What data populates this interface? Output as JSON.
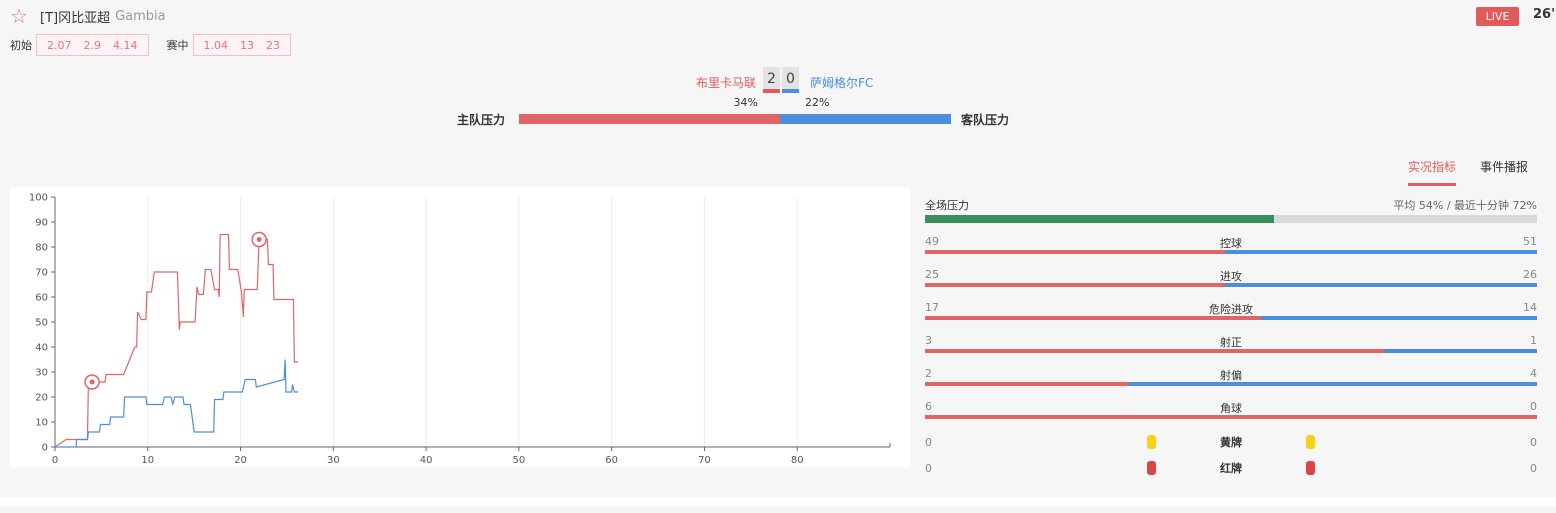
{
  "header": {
    "favorite_icon": "star-outline-icon",
    "league": "[T]冈比亚超",
    "league_en": "Gambia",
    "status": "LIVE",
    "minute": "26'"
  },
  "odds": {
    "initial_label": "初始",
    "initial": [
      "2.07",
      "2.9",
      "4.14"
    ],
    "live_label": "赛中",
    "live": [
      "1.04",
      "13",
      "23"
    ]
  },
  "match": {
    "home_team": "布里卡马联",
    "away_team": "萨姆格尔FC",
    "home_score": "2",
    "away_score": "0",
    "home_pct": "34%",
    "away_pct": "22%",
    "home_pressure_label": "主队压力",
    "away_pressure_label": "客队压力",
    "home_pressure_share": 0.605,
    "colors": {
      "home": "#e15b5b",
      "away": "#4b8fdc"
    }
  },
  "tabs": [
    {
      "label": "实况指标",
      "active": true
    },
    {
      "label": "事件播报",
      "active": false
    }
  ],
  "stats": {
    "total_label": "全场压力",
    "total_summary": "平均 54% / 最近十分钟 72%",
    "total_fill": 0.57,
    "rows": [
      {
        "name": "控球",
        "home": "49",
        "away": "51"
      },
      {
        "name": "进攻",
        "home": "25",
        "away": "26"
      },
      {
        "name": "危险进攻",
        "home": "17",
        "away": "14"
      },
      {
        "name": "射正",
        "home": "3",
        "away": "1"
      },
      {
        "name": "射偏",
        "home": "2",
        "away": "4"
      },
      {
        "name": "角球",
        "home": "6",
        "away": "0"
      }
    ],
    "cards": [
      {
        "name": "黄牌",
        "home": "0",
        "away": "0",
        "type": "yellow"
      },
      {
        "name": "红牌",
        "home": "0",
        "away": "0",
        "type": "red"
      }
    ]
  },
  "chart_data": {
    "type": "line",
    "title": "",
    "xlabel": "",
    "ylabel": "",
    "xlim": [
      0,
      90
    ],
    "ylim": [
      0,
      100
    ],
    "x_ticks": [
      0,
      10,
      20,
      30,
      40,
      50,
      60,
      70,
      80
    ],
    "y_ticks": [
      0,
      10,
      20,
      30,
      40,
      50,
      60,
      70,
      80,
      90,
      100
    ],
    "grid": "vertical",
    "series": [
      {
        "name": "home",
        "color": "#e06666",
        "points": [
          [
            0,
            0
          ],
          [
            1.2,
            3
          ],
          [
            3.5,
            3
          ],
          [
            3.6,
            26
          ],
          [
            5.4,
            26
          ],
          [
            5.5,
            29
          ],
          [
            7.4,
            29
          ],
          [
            8.6,
            40
          ],
          [
            8.8,
            40
          ],
          [
            8.9,
            54
          ],
          [
            9.3,
            51
          ],
          [
            9.8,
            51
          ],
          [
            9.9,
            62
          ],
          [
            10.4,
            62
          ],
          [
            10.7,
            70
          ],
          [
            13.2,
            70
          ],
          [
            13.4,
            47
          ],
          [
            13.5,
            50
          ],
          [
            15.1,
            50
          ],
          [
            15.3,
            64
          ],
          [
            15.5,
            61
          ],
          [
            16,
            61
          ],
          [
            16.2,
            71
          ],
          [
            16.8,
            71
          ],
          [
            17.2,
            63
          ],
          [
            17.6,
            63
          ],
          [
            17.7,
            60
          ],
          [
            17.8,
            85
          ],
          [
            18.7,
            85
          ],
          [
            18.8,
            71
          ],
          [
            19.7,
            71
          ],
          [
            20.1,
            62
          ],
          [
            20.3,
            52
          ],
          [
            20.4,
            63
          ],
          [
            21.8,
            63
          ],
          [
            22,
            83
          ],
          [
            22.9,
            83
          ],
          [
            23,
            73
          ],
          [
            23.5,
            73
          ],
          [
            23.6,
            59
          ],
          [
            25.7,
            59
          ],
          [
            25.8,
            34
          ],
          [
            26.2,
            34
          ]
        ]
      },
      {
        "name": "away",
        "color": "#4b8fdc",
        "points": [
          [
            0,
            0
          ],
          [
            2.3,
            0
          ],
          [
            2.3,
            3
          ],
          [
            3.5,
            3
          ],
          [
            3.6,
            6
          ],
          [
            4.8,
            6
          ],
          [
            4.9,
            9
          ],
          [
            5.9,
            9
          ],
          [
            6,
            12
          ],
          [
            7.4,
            12
          ],
          [
            7.5,
            20
          ],
          [
            9.8,
            20
          ],
          [
            9.9,
            17
          ],
          [
            11.6,
            17
          ],
          [
            11.8,
            20
          ],
          [
            12.5,
            20
          ],
          [
            12.7,
            17
          ],
          [
            12.9,
            20
          ],
          [
            13.8,
            20
          ],
          [
            13.9,
            17
          ],
          [
            14.6,
            17
          ],
          [
            15,
            6
          ],
          [
            17.1,
            6
          ],
          [
            17.2,
            19
          ],
          [
            18.1,
            19
          ],
          [
            18.2,
            22
          ],
          [
            20.2,
            22
          ],
          [
            20.5,
            27
          ],
          [
            21.6,
            27
          ],
          [
            21.7,
            24
          ],
          [
            24.7,
            27
          ],
          [
            24.8,
            35
          ],
          [
            24.9,
            22
          ],
          [
            25.5,
            22
          ],
          [
            25.6,
            25
          ],
          [
            25.8,
            22
          ],
          [
            26.2,
            22
          ]
        ]
      }
    ],
    "events": [
      {
        "type": "goal",
        "team": "home",
        "minute": 4,
        "value": 26
      },
      {
        "type": "goal",
        "team": "home",
        "minute": 22,
        "value": 83
      }
    ]
  }
}
